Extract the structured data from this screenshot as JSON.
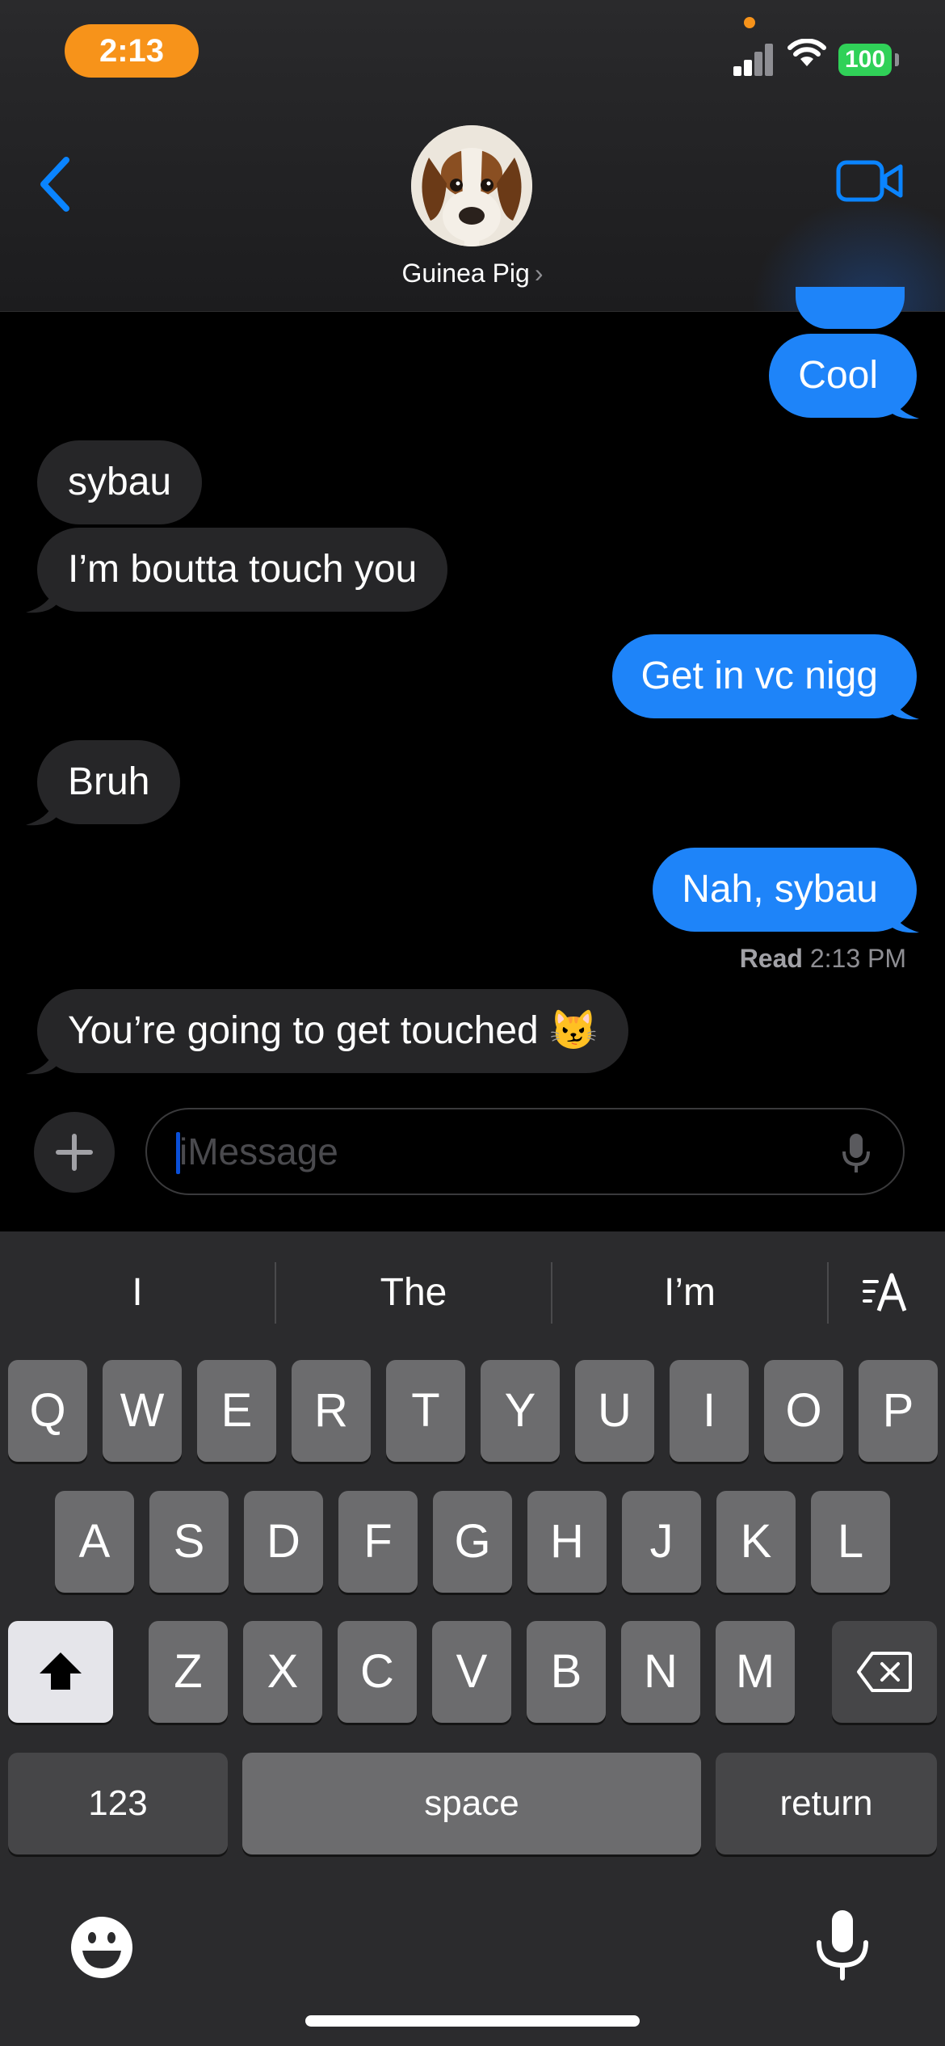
{
  "status_bar": {
    "time": "2:13",
    "battery": "100"
  },
  "header": {
    "contact_name": "Guinea Pig",
    "chevron": "›",
    "back_icon": "chevron-left-icon",
    "video_icon": "video-camera-icon"
  },
  "messages": [
    {
      "side": "sent",
      "text": "Cool"
    },
    {
      "side": "received",
      "text": "sybau"
    },
    {
      "side": "received",
      "text": "I’m boutta touch you"
    },
    {
      "side": "sent",
      "text": "Get in vc nigg"
    },
    {
      "side": "received",
      "text": "Bruh"
    },
    {
      "side": "sent",
      "text": "Nah, sybau"
    },
    {
      "side": "received",
      "text": "You’re going to get touched 😼"
    }
  ],
  "read_receipt": {
    "label": "Read",
    "time": "2:13 PM"
  },
  "composer": {
    "placeholder": "iMessage",
    "plus_icon": "plus-icon",
    "mic_icon": "microphone-icon"
  },
  "keyboard": {
    "suggestions": [
      "I",
      "The",
      "I’m"
    ],
    "row1": [
      "Q",
      "W",
      "E",
      "R",
      "T",
      "Y",
      "U",
      "I",
      "O",
      "P"
    ],
    "row2": [
      "A",
      "S",
      "D",
      "F",
      "G",
      "H",
      "J",
      "K",
      "L"
    ],
    "row3": [
      "Z",
      "X",
      "C",
      "V",
      "B",
      "N",
      "M"
    ],
    "numbers_label": "123",
    "space_label": "space",
    "return_label": "return",
    "emoji_icon": "emoji-icon",
    "dictation_icon": "microphone-icon"
  },
  "colors": {
    "sent_bubble": "#1e84f9",
    "received_bubble": "#262628",
    "accent": "#0a84ff",
    "time_pill": "#f7931a",
    "battery": "#30d158"
  }
}
